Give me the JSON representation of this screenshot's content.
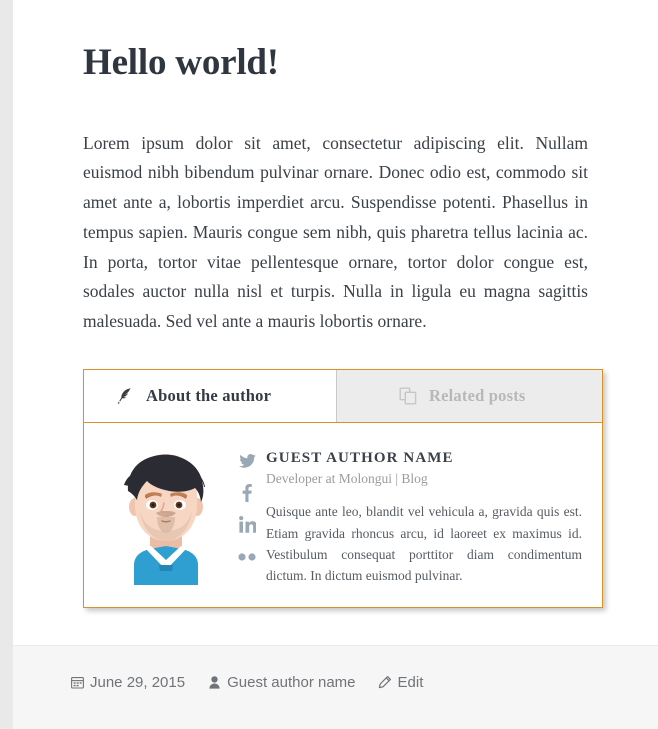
{
  "post": {
    "title": "Hello world!",
    "body": "Lorem ipsum dolor sit amet, consectetur adipiscing elit. Nullam euismod nibh bibendum pulvinar ornare. Donec odio est, commodo sit amet ante a, lobortis imperdiet arcu. Suspendisse potenti. Phasellus in tempus sapien. Mauris congue sem nibh, quis pharetra tellus lacinia ac. In porta, tortor vitae pellentesque ornare, tortor dolor congue est, sodales auctor nulla nisl et turpis. Nulla in ligula eu magna sagittis malesuada. Sed vel ante a mauris lobortis ornare."
  },
  "author_box": {
    "accent_color": "#d7922a",
    "tabs": [
      {
        "label": "About the author",
        "icon": "quill-icon",
        "active": true
      },
      {
        "label": "Related posts",
        "icon": "copy-pages-icon",
        "active": false
      }
    ],
    "avatar": {
      "icon": "avatar-illustration",
      "hair_color": "#2b2b33",
      "skin_color": "#f3d3c0",
      "shirt_color": "#2e9fd0"
    },
    "social": [
      {
        "name": "twitter-icon",
        "glyph": "twitter"
      },
      {
        "name": "facebook-icon",
        "glyph": "facebook"
      },
      {
        "name": "linkedin-icon",
        "glyph": "linkedin"
      },
      {
        "name": "flickr-icon",
        "glyph": "flickr"
      }
    ],
    "author_name": "GUEST AUTHOR NAME",
    "author_role_prefix": "Developer at Molongui | ",
    "author_role_link": "Blog",
    "author_bio": "Quisque ante leo, blandit vel vehicula a, gravida quis est. Etiam gravida rhoncus arcu, id laoreet ex maximus id. Vestibulum consequat porttitor diam condimentum dictum. In dictum euismod pulvinar."
  },
  "footer": {
    "date": "June 29, 2015",
    "author": "Guest author name",
    "edit": "Edit",
    "date_icon": "calendar-icon",
    "author_icon": "user-icon",
    "edit_icon": "pencil-icon"
  }
}
